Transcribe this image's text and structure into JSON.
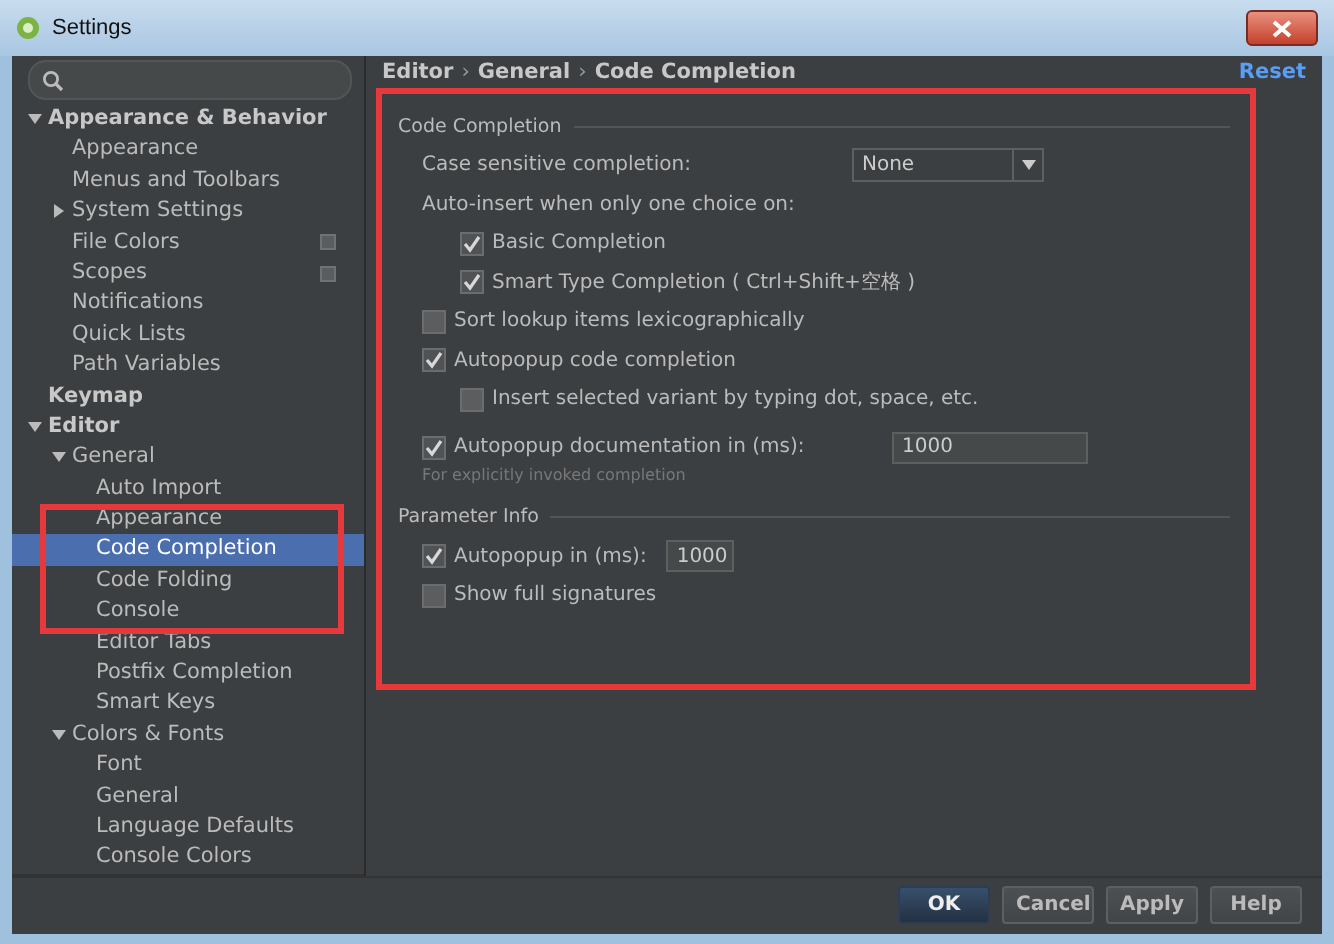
{
  "window": {
    "title": "Settings"
  },
  "sidebar": {
    "tree": [
      {
        "label": "Appearance & Behavior",
        "expanded": true,
        "selected": false,
        "children": [
          {
            "label": "Appearance",
            "selected": false
          },
          {
            "label": "Menus and Toolbars",
            "selected": false
          },
          {
            "label": "System Settings",
            "expanded": false,
            "selected": false
          },
          {
            "label": "File Colors",
            "selected": false,
            "project_scope": true
          },
          {
            "label": "Scopes",
            "selected": false,
            "project_scope": true
          },
          {
            "label": "Notifications",
            "selected": false
          },
          {
            "label": "Quick Lists",
            "selected": false
          },
          {
            "label": "Path Variables",
            "selected": false
          }
        ]
      },
      {
        "label": "Keymap",
        "selected": false
      },
      {
        "label": "Editor",
        "expanded": true,
        "selected": false,
        "children": [
          {
            "label": "General",
            "expanded": true,
            "selected": false,
            "children": [
              {
                "label": "Auto Import",
                "selected": false
              },
              {
                "label": "Appearance",
                "selected": false
              },
              {
                "label": "Code Completion",
                "selected": true
              },
              {
                "label": "Code Folding",
                "selected": false
              },
              {
                "label": "Console",
                "selected": false
              },
              {
                "label": "Editor Tabs",
                "selected": false
              },
              {
                "label": "Postfix Completion",
                "selected": false
              },
              {
                "label": "Smart Keys",
                "selected": false
              }
            ]
          },
          {
            "label": "Colors & Fonts",
            "expanded": true,
            "selected": false,
            "children": [
              {
                "label": "Font",
                "selected": false
              },
              {
                "label": "General",
                "selected": false
              },
              {
                "label": "Language Defaults",
                "selected": false
              },
              {
                "label": "Console Colors",
                "selected": false
              }
            ]
          }
        ]
      }
    ]
  },
  "breadcrumb": [
    "Editor",
    "General",
    "Code Completion"
  ],
  "breadcrumb_separator": "›",
  "reset_link": "Reset",
  "groups": [
    {
      "title": "Code Completion",
      "items": [
        {
          "kind": "select",
          "label": "Case sensitive completion:",
          "value": "None"
        },
        {
          "kind": "label",
          "label": "Auto-insert when only one choice on:",
          "children": [
            {
              "kind": "checkbox",
              "label": "Basic Completion",
              "checked": true
            },
            {
              "kind": "checkbox",
              "label": "Smart Type Completion ( Ctrl+Shift+空格 )",
              "checked": true
            }
          ]
        },
        {
          "kind": "checkbox",
          "label": "Sort lookup items lexicographically",
          "checked": false
        },
        {
          "kind": "checkbox",
          "label": "Autopopup code completion",
          "checked": true,
          "children": [
            {
              "kind": "checkbox",
              "label": "Insert selected variant by typing dot, space, etc.",
              "checked": false
            }
          ]
        },
        {
          "kind": "checkbox",
          "label": "Autopopup documentation in (ms):",
          "checked": true,
          "value": "1000",
          "hint": "For explicitly invoked completion"
        }
      ]
    },
    {
      "title": "Parameter Info",
      "items": [
        {
          "kind": "checkbox",
          "label": "Autopopup in (ms):",
          "checked": true,
          "value": "1000"
        },
        {
          "kind": "checkbox",
          "label": "Show full signatures",
          "checked": false
        }
      ]
    }
  ],
  "buttons": [
    {
      "label": "OK",
      "default": true
    },
    {
      "label": "Cancel",
      "default": false
    },
    {
      "label": "Apply",
      "default": false
    },
    {
      "label": "Help",
      "default": false
    }
  ]
}
